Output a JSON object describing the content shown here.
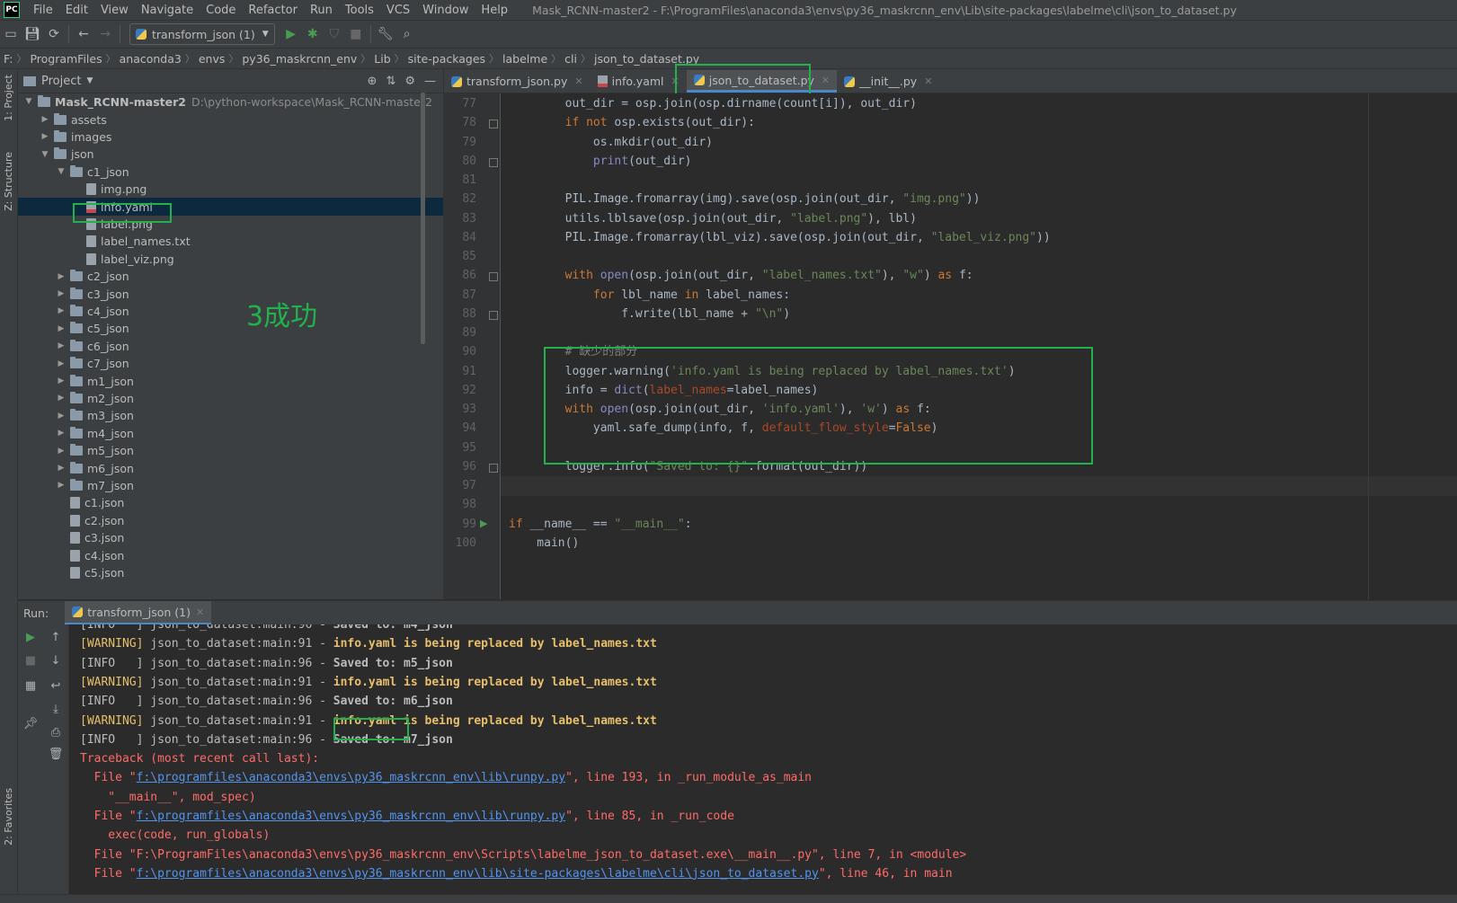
{
  "app": {
    "logo": "PC",
    "window_title": "Mask_RCNN-master2 - F:\\ProgramFiles\\anaconda3\\envs\\py36_maskrcnn_env\\Lib\\site-packages\\labelme\\cli\\json_to_dataset.py"
  },
  "menu": [
    "File",
    "Edit",
    "View",
    "Navigate",
    "Code",
    "Refactor",
    "Run",
    "Tools",
    "VCS",
    "Window",
    "Help"
  ],
  "toolbar": {
    "run_config": "transform_json (1)",
    "icons": [
      "save-all-icon",
      "sync-icon",
      "back-icon",
      "forward-icon",
      "run-icon",
      "debug-icon",
      "coverage-icon",
      "stop-icon",
      "settings-wrench-icon",
      "search-icon"
    ]
  },
  "breadcrumb": [
    "F:",
    "ProgramFiles",
    "anaconda3",
    "envs",
    "py36_maskrcnn_env",
    "Lib",
    "site-packages",
    "labelme",
    "cli",
    "json_to_dataset.py"
  ],
  "side_labels": {
    "project": "1: Project",
    "structure": "Z: Structure",
    "favorites": "2: Favorites"
  },
  "project": {
    "title": "Project",
    "root": {
      "name": "Mask_RCNN-master2",
      "path": "D:\\python-workspace\\Mask_RCNN-master2"
    },
    "tree": [
      {
        "label": "assets",
        "kind": "folder",
        "depth": 1,
        "arrow": "right"
      },
      {
        "label": "images",
        "kind": "folder",
        "depth": 1,
        "arrow": "right"
      },
      {
        "label": "json",
        "kind": "folder",
        "depth": 1,
        "arrow": "down"
      },
      {
        "label": "c1_json",
        "kind": "folder",
        "depth": 2,
        "arrow": "down"
      },
      {
        "label": "img.png",
        "kind": "file",
        "depth": 3
      },
      {
        "label": "info.yaml",
        "kind": "yaml",
        "depth": 3,
        "selected": true
      },
      {
        "label": "label.png",
        "kind": "file",
        "depth": 3
      },
      {
        "label": "label_names.txt",
        "kind": "file",
        "depth": 3
      },
      {
        "label": "label_viz.png",
        "kind": "file",
        "depth": 3
      },
      {
        "label": "c2_json",
        "kind": "folder",
        "depth": 2,
        "arrow": "right"
      },
      {
        "label": "c3_json",
        "kind": "folder",
        "depth": 2,
        "arrow": "right"
      },
      {
        "label": "c4_json",
        "kind": "folder",
        "depth": 2,
        "arrow": "right"
      },
      {
        "label": "c5_json",
        "kind": "folder",
        "depth": 2,
        "arrow": "right"
      },
      {
        "label": "c6_json",
        "kind": "folder",
        "depth": 2,
        "arrow": "right"
      },
      {
        "label": "c7_json",
        "kind": "folder",
        "depth": 2,
        "arrow": "right"
      },
      {
        "label": "m1_json",
        "kind": "folder",
        "depth": 2,
        "arrow": "right"
      },
      {
        "label": "m2_json",
        "kind": "folder",
        "depth": 2,
        "arrow": "right"
      },
      {
        "label": "m3_json",
        "kind": "folder",
        "depth": 2,
        "arrow": "right"
      },
      {
        "label": "m4_json",
        "kind": "folder",
        "depth": 2,
        "arrow": "right"
      },
      {
        "label": "m5_json",
        "kind": "folder",
        "depth": 2,
        "arrow": "right"
      },
      {
        "label": "m6_json",
        "kind": "folder",
        "depth": 2,
        "arrow": "right"
      },
      {
        "label": "m7_json",
        "kind": "folder",
        "depth": 2,
        "arrow": "right"
      },
      {
        "label": "c1.json",
        "kind": "json",
        "depth": 2
      },
      {
        "label": "c2.json",
        "kind": "json",
        "depth": 2
      },
      {
        "label": "c3.json",
        "kind": "json",
        "depth": 2
      },
      {
        "label": "c4.json",
        "kind": "json",
        "depth": 2
      },
      {
        "label": "c5.json",
        "kind": "json",
        "depth": 2
      }
    ]
  },
  "annotation": {
    "success_note": "3成功"
  },
  "editor_tabs": [
    {
      "label": "transform_json.py",
      "icon": "python-file-icon",
      "active": false
    },
    {
      "label": "info.yaml",
      "icon": "yaml-file-icon",
      "active": false
    },
    {
      "label": "json_to_dataset.py",
      "icon": "python-file-icon",
      "active": true
    },
    {
      "label": "__init__.py",
      "icon": "python-file-icon",
      "active": false
    }
  ],
  "editor": {
    "lines": [
      {
        "n": "77",
        "html": "        out_dir = osp.join(osp.dirname(count[i]), out_dir)"
      },
      {
        "n": "78",
        "html": "        <span class='k'>if not</span> osp.exists(out_dir):"
      },
      {
        "n": "79",
        "html": "            os.mkdir(out_dir)"
      },
      {
        "n": "80",
        "html": "            <span class='b'>print</span>(out_dir)"
      },
      {
        "n": "81",
        "html": ""
      },
      {
        "n": "82",
        "html": "        PIL.Image.fromarray(img).save(osp.join(out_dir, <span class='s'>\"img.png\"</span>))"
      },
      {
        "n": "83",
        "html": "        utils.lblsave(osp.join(out_dir, <span class='s'>\"label.png\"</span>), lbl)"
      },
      {
        "n": "84",
        "html": "        PIL.Image.fromarray(lbl_viz).save(osp.join(out_dir, <span class='s'>\"label_viz.png\"</span>))"
      },
      {
        "n": "85",
        "html": ""
      },
      {
        "n": "86",
        "html": "        <span class='k'>with</span> <span class='b'>open</span>(osp.join(out_dir, <span class='s'>\"label_names.txt\"</span>), <span class='s'>\"w\"</span>) <span class='k'>as</span> f:"
      },
      {
        "n": "87",
        "html": "            <span class='k'>for</span> lbl_name <span class='k'>in</span> label_names:"
      },
      {
        "n": "88",
        "html": "                f.write(lbl_name + <span class='s'>\"\\n\"</span>)"
      },
      {
        "n": "89",
        "html": ""
      },
      {
        "n": "90",
        "html": "        <span class='c'># 缺少的部分</span>"
      },
      {
        "n": "91",
        "html": "        logger.warning(<span class='s'>'info.yaml is being replaced by label_names.txt'</span>)"
      },
      {
        "n": "92",
        "html": "        info = <span class='b'>dict</span>(<span class='p'>label_names</span>=label_names)"
      },
      {
        "n": "93",
        "html": "        <span class='k'>with</span> <span class='b'>open</span>(osp.join(out_dir, <span class='s'>'info.yaml'</span>), <span class='s'>'w'</span>) <span class='k'>as</span> f:"
      },
      {
        "n": "94",
        "html": "            yaml.safe_dump(info, f, <span class='p'>default_flow_style</span>=<span class='k'>False</span>)"
      },
      {
        "n": "95",
        "html": ""
      },
      {
        "n": "96",
        "html": "        logger.info(<span class='s'>\"Saved to: {}\"</span>.format(out_dir))"
      },
      {
        "n": "97",
        "html": ""
      },
      {
        "n": "98",
        "html": ""
      },
      {
        "n": "99",
        "html": "<span class='k'>if</span> __name__ == <span class='s'>\"__main__\"</span>:"
      },
      {
        "n": "100",
        "html": "    main()"
      }
    ]
  },
  "run_panel": {
    "label": "Run:",
    "tab": "transform_json (1)",
    "console": [
      {
        "cls": "info",
        "html": "[INFO   ] json_to_dataset:main:96 - <b>Saved to: m4_json</b>"
      },
      {
        "cls": "warn",
        "html": "[WARNING] <span style='color:#bbbbbb'>json_to_dataset:main:91 -</span> <b>info.yaml is being replaced by label_names.txt</b>"
      },
      {
        "cls": "info",
        "html": "[INFO   ] json_to_dataset:main:96 - <b>Saved to: m5_json</b>"
      },
      {
        "cls": "warn",
        "html": "[WARNING] <span style='color:#bbbbbb'>json_to_dataset:main:91 -</span> <b>info.yaml is being replaced by label_names.txt</b>"
      },
      {
        "cls": "info",
        "html": "[INFO   ] json_to_dataset:main:96 - <b>Saved to: m6_json</b>"
      },
      {
        "cls": "warn",
        "html": "[WARNING] <span style='color:#bbbbbb'>json_to_dataset:main:91 -</span> <b>info.yaml is being replaced by label_names.txt</b>"
      },
      {
        "cls": "info",
        "html": "[INFO   ] json_to_dataset:main:96 - <b>Saved to: m7_json</b>"
      },
      {
        "cls": "err",
        "html": "Traceback (most recent call last):"
      },
      {
        "cls": "err",
        "html": "  File \"<span class='link'>f:\\programfiles\\anaconda3\\envs\\py36_maskrcnn_env\\lib\\runpy.py</span>\", line 193, in _run_module_as_main"
      },
      {
        "cls": "err",
        "html": "    \"__main__\", mod_spec)"
      },
      {
        "cls": "err",
        "html": "  File \"<span class='link'>f:\\programfiles\\anaconda3\\envs\\py36_maskrcnn_env\\lib\\runpy.py</span>\", line 85, in _run_code"
      },
      {
        "cls": "err",
        "html": "    exec(code, run_globals)"
      },
      {
        "cls": "err",
        "html": "  File \"F:\\ProgramFiles\\anaconda3\\envs\\py36_maskrcnn_env\\Scripts\\labelme_json_to_dataset.exe\\__main__.py\", line 7, in &lt;module&gt;"
      },
      {
        "cls": "err",
        "html": "  File \"<span class='link'>f:\\programfiles\\anaconda3\\envs\\py36_maskrcnn_env\\lib\\site-packages\\labelme\\cli\\json_to_dataset.py</span>\", line 46, in main"
      }
    ]
  },
  "colors": {
    "accent": "#4a88c7",
    "highlight_box": "#22b14c",
    "warning": "#e8bf6a",
    "error": "#ff6b68"
  }
}
